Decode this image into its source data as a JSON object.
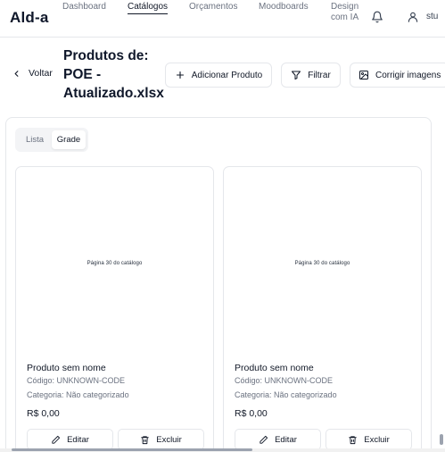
{
  "app": {
    "brand": "Ald-a"
  },
  "nav": {
    "items": [
      {
        "label": "Dashboard"
      },
      {
        "label": "Catálogos"
      },
      {
        "label": "Orçamentos"
      },
      {
        "label": "Moodboards"
      },
      {
        "label": "Design com IA"
      }
    ],
    "user_label": "stu"
  },
  "header": {
    "back_label": "Voltar",
    "title": "Produtos de: POE - Atualizado.xlsx",
    "add_product_label": "Adicionar Produto",
    "filter_label": "Filtrar",
    "fix_images_label": "Corrigir imagens"
  },
  "view_toggle": {
    "options": [
      "Lista",
      "Grade"
    ],
    "selected": "Grade"
  },
  "products": [
    {
      "image_caption": "Página 30 do catálogo",
      "name": "Produto sem nome",
      "code": "Código: UNKNOWN-CODE",
      "category": "Categoria: Não categorizado",
      "price": "R$ 0,00",
      "edit_label": "Editar",
      "delete_label": "Excluir"
    },
    {
      "image_caption": "Página 30 do catálogo",
      "name": "Produto sem nome",
      "code": "Código: UNKNOWN-CODE",
      "category": "Categoria: Não categorizado",
      "price": "R$ 0,00",
      "edit_label": "Editar",
      "delete_label": "Excluir"
    }
  ],
  "icons": {
    "bell": "bell-icon",
    "user": "user-icon",
    "back": "chevron-left-icon",
    "add": "plus-icon",
    "filter": "filter-icon",
    "fix_images": "image-icon",
    "edit": "pencil-icon",
    "delete": "trash-icon"
  }
}
